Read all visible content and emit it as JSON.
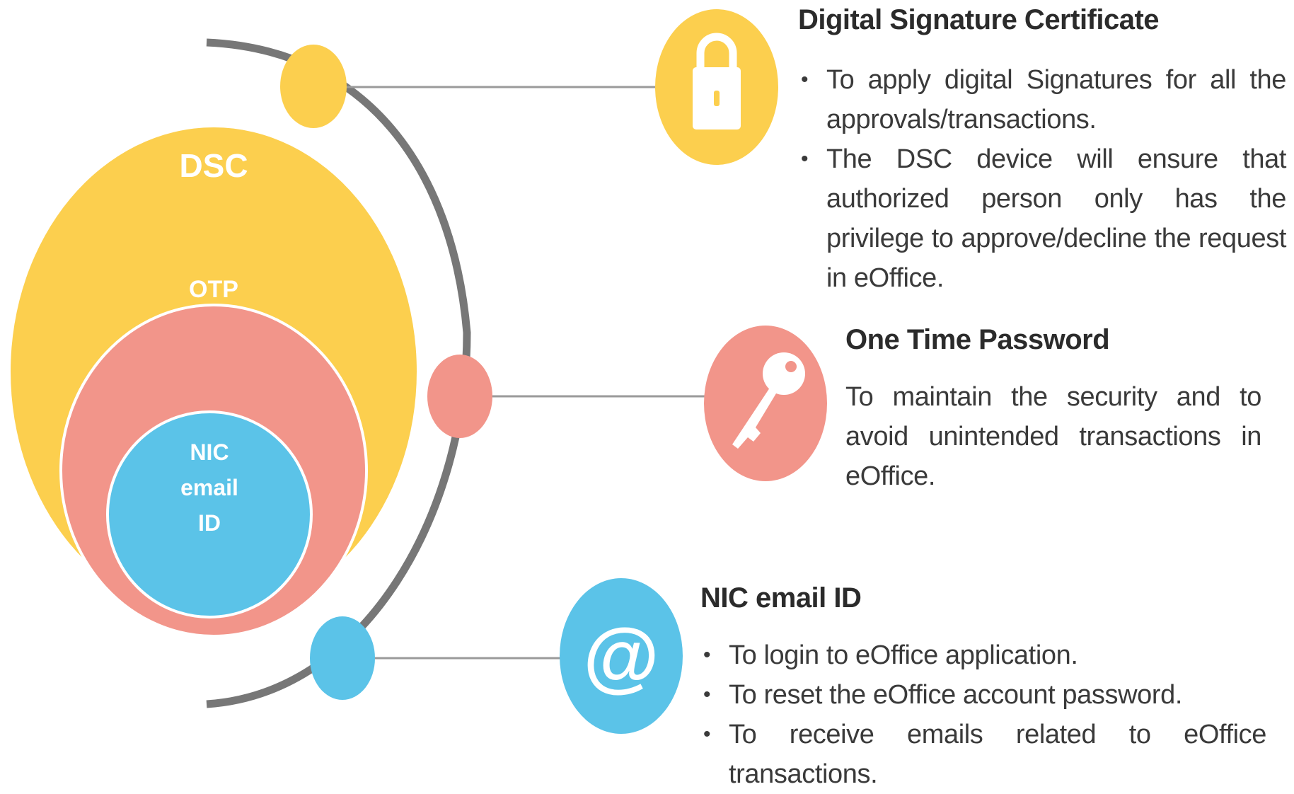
{
  "colors": {
    "dsc": "#FCCF4E",
    "otp": "#F2958A",
    "email": "#5BC3E8",
    "arc": "#777777",
    "connector": "#9a9a9a"
  },
  "rings": {
    "dsc": "DSC",
    "otp": "OTP",
    "email_lines": [
      "NIC",
      "email",
      "ID"
    ]
  },
  "sections": {
    "dsc": {
      "icon": "padlock-icon",
      "title": "Digital Signature Certificate",
      "bullets": [
        "To apply digital Signatures for all the approvals/transactions.",
        "The DSC device will ensure that authorized person only has the privilege to approve/decline the request in eOffice."
      ]
    },
    "otp": {
      "icon": "key-icon",
      "title": "One Time Password",
      "text": "To maintain the security and to avoid unintended transactions in eOffice."
    },
    "email": {
      "icon": "at-sign-icon",
      "title": "NIC email ID",
      "bullets": [
        "To login to eOffice application.",
        "To reset the eOffice account password.",
        "To receive emails related to eOffice transactions."
      ]
    }
  }
}
